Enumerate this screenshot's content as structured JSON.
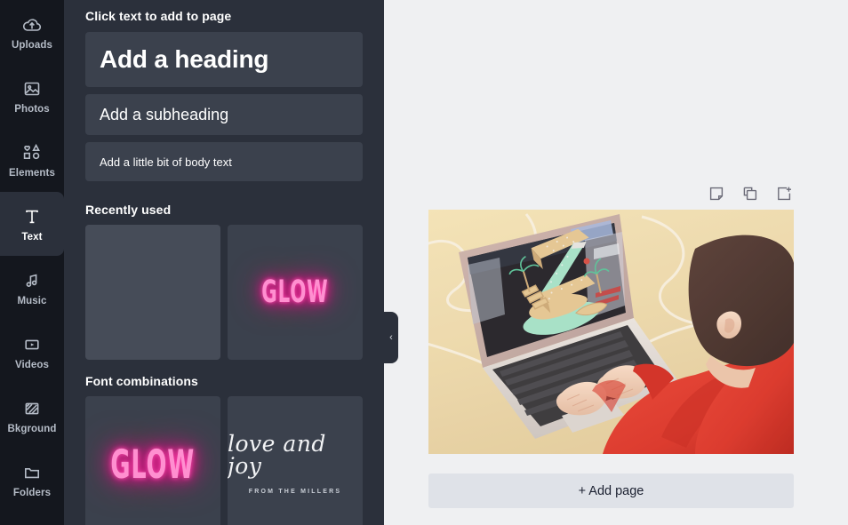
{
  "sidebar": {
    "items": [
      {
        "label": "Uploads",
        "icon": "upload-cloud-icon",
        "active": false
      },
      {
        "label": "Photos",
        "icon": "photo-icon",
        "active": false
      },
      {
        "label": "Elements",
        "icon": "shapes-icon",
        "active": false
      },
      {
        "label": "Text",
        "icon": "text-t-icon",
        "active": true
      },
      {
        "label": "Music",
        "icon": "music-note-icon",
        "active": false
      },
      {
        "label": "Videos",
        "icon": "video-play-icon",
        "active": false
      },
      {
        "label": "Bkground",
        "icon": "hatch-pattern-icon",
        "active": false
      },
      {
        "label": "Folders",
        "icon": "folder-icon",
        "active": false
      }
    ]
  },
  "panel": {
    "title": "Click text to add to page",
    "text_buttons": [
      {
        "label": "Add a heading",
        "style": "heading"
      },
      {
        "label": "Add a subheading",
        "style": "subheading"
      },
      {
        "label": "Add a little bit of body text",
        "style": "body"
      }
    ],
    "recently_used": {
      "title": "Recently used",
      "items": [
        {
          "kind": "blank",
          "label": ""
        },
        {
          "kind": "glow",
          "label": "GLOW"
        }
      ]
    },
    "font_combinations": {
      "title": "Font combinations",
      "items": [
        {
          "kind": "glow",
          "label": "GLOW"
        },
        {
          "kind": "script",
          "label": "love and joy",
          "sublabel": "FROM THE MILLERS"
        }
      ]
    }
  },
  "canvas": {
    "collapse_handle": "‹",
    "page_tools": [
      {
        "name": "notes-icon",
        "title": "Notes"
      },
      {
        "name": "duplicate-icon",
        "title": "Duplicate page"
      },
      {
        "name": "add-page-icon",
        "title": "Add page"
      }
    ],
    "add_page_label": "+ Add page",
    "page_image_alt": "Person in red sweater working on a laptop showing a 3D letter Z illustration"
  },
  "colors": {
    "rail_bg": "#14171e",
    "panel_bg": "#2b303b",
    "card_bg": "#3b414d",
    "canvas_bg": "#eff0f2",
    "neon_pink": "#ff1493",
    "neon_text": "#ff8fd0",
    "add_page_bg": "#dfe2e8"
  }
}
